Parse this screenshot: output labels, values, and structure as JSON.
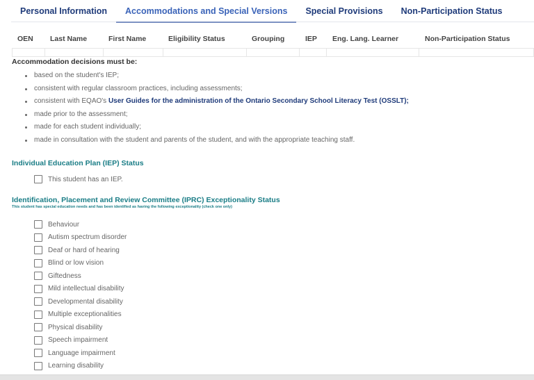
{
  "tabs": [
    {
      "label": "Personal Information",
      "active": false
    },
    {
      "label": "Accommodations and Special Versions",
      "active": true
    },
    {
      "label": "Special Provisions",
      "active": false
    },
    {
      "label": "Non-Participation Status",
      "active": false
    }
  ],
  "grid": {
    "columns": [
      "OEN",
      "Last Name",
      "First Name",
      "Eligibility Status",
      "Grouping",
      "IEP",
      "Eng. Lang. Learner",
      "Non-Participation Status"
    ],
    "rows": [
      [
        "",
        "",
        "",
        "",
        "",
        "",
        "",
        ""
      ]
    ]
  },
  "intro": "Accommodation decisions must be:",
  "rules": [
    {
      "text": "based on the student's IEP;"
    },
    {
      "text": "consistent with regular classroom practices, including assessments;"
    },
    {
      "prefix": "consistent with EQAO's ",
      "link": "User Guides for the administration of the Ontario Secondary School Literacy Test (OSSLT);"
    },
    {
      "text": "made prior to the assessment;"
    },
    {
      "text": "made for each student individually;"
    },
    {
      "text": "made in consultation with the student and parents of the student, and with the appropriate teaching staff."
    }
  ],
  "iep": {
    "heading": "Individual Education Plan (IEP) Status",
    "checkbox_label": "This student has an IEP.",
    "checked": false
  },
  "iprc": {
    "heading": "Identification, Placement and Review Committee (IPRC) Exceptionality Status",
    "subheading": "This student has special education needs and has been identified as having the following exceptionality (check one only)",
    "options": [
      {
        "label": "Behaviour",
        "checked": false
      },
      {
        "label": "Autism spectrum disorder",
        "checked": false
      },
      {
        "label": "Deaf or hard of hearing",
        "checked": false
      },
      {
        "label": "Blind or low vision",
        "checked": false
      },
      {
        "label": "Giftedness",
        "checked": false
      },
      {
        "label": "Mild intellectual disability",
        "checked": false
      },
      {
        "label": "Developmental disability",
        "checked": false
      },
      {
        "label": "Multiple exceptionalities",
        "checked": false
      },
      {
        "label": "Physical disability",
        "checked": false
      },
      {
        "label": "Speech impairment",
        "checked": false
      },
      {
        "label": "Language impairment",
        "checked": false
      },
      {
        "label": "Learning disability",
        "checked": false
      }
    ]
  }
}
